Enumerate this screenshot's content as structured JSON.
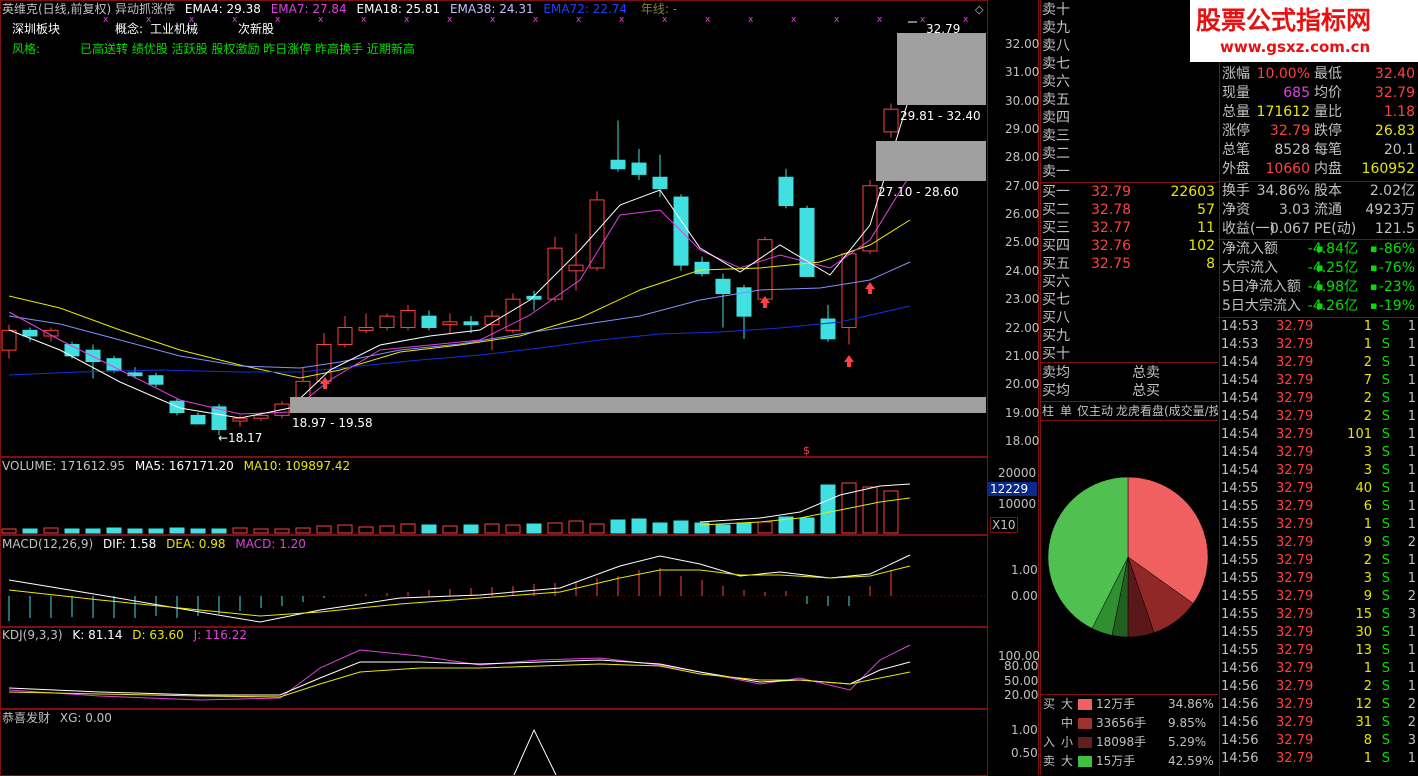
{
  "header": {
    "stock_title": "英维克(日线,前复权)",
    "indicator_name": "异动抓涨停",
    "ema4": "EMA4: 29.38",
    "ema7": "EMA7: 27.84",
    "ema18": "EMA18: 25.81",
    "ema38": "EMA38: 24.31",
    "ema72": "EMA72: 22.74",
    "year_line": "年线: -",
    "sector_label": "深圳板块",
    "concept_label": "概念:",
    "concept_value": "工业机械",
    "new_stock": "次新股",
    "style_label": "风格:",
    "style_value": "已高送转 绩优股 活跃股 股权激励 昨日涨停 昨高换手 近期新高"
  },
  "main_chart": {
    "y_ticks": [
      "32.00",
      "31.00",
      "30.00",
      "29.00",
      "28.00",
      "27.00",
      "26.00",
      "25.00",
      "24.00",
      "23.00",
      "22.00",
      "21.00",
      "20.00",
      "19.00",
      "18.00"
    ],
    "labels": {
      "top_price": "32.79",
      "range_upper": "29.81 - 32.40",
      "range_mid": "27.10 - 28.60",
      "range_lower": "18.97 - 19.58",
      "low_price": "←18.17",
      "marker_s": "$"
    }
  },
  "volume": {
    "title": "VOLUME: 171612.95",
    "ma5": "MA5: 167171.20",
    "ma10": "MA10: 109897.42",
    "y_ticks": [
      "20000",
      "10000"
    ],
    "highlight": "12229",
    "unit": "X10"
  },
  "macd": {
    "title": "MACD(12,26,9)",
    "dif": "DIF: 1.58",
    "dea": "DEA: 0.98",
    "macd": "MACD: 1.20",
    "y_ticks": [
      "1.00",
      "0.00"
    ]
  },
  "kdj": {
    "title": "KDJ(9,3,3)",
    "k": "K: 81.14",
    "d": "D: 63.60",
    "j": "J: 116.22",
    "y_ticks": [
      "100.00",
      "80.00",
      "50.00",
      "20.00"
    ]
  },
  "xg": {
    "title": "恭喜发财",
    "value": "XG: 0.00",
    "y_ticks": [
      "1.00",
      "0.50"
    ]
  },
  "sell_levels": [
    "卖十",
    "卖九",
    "卖八",
    "卖七",
    "卖六",
    "卖五",
    "卖四",
    "卖三",
    "卖二",
    "卖一"
  ],
  "buy_levels": [
    {
      "label": "买一",
      "price": "32.79",
      "vol": "22603"
    },
    {
      "label": "买二",
      "price": "32.78",
      "vol": "57"
    },
    {
      "label": "买三",
      "price": "32.77",
      "vol": "11"
    },
    {
      "label": "买四",
      "price": "32.76",
      "vol": "102"
    },
    {
      "label": "买五",
      "price": "32.75",
      "vol": "8"
    },
    {
      "label": "买六",
      "price": "",
      "vol": ""
    },
    {
      "label": "买七",
      "price": "",
      "vol": ""
    },
    {
      "label": "买八",
      "price": "",
      "vol": ""
    },
    {
      "label": "买九",
      "price": "",
      "vol": ""
    },
    {
      "label": "买十",
      "price": "",
      "vol": ""
    }
  ],
  "avg": {
    "sell_avg": "卖均",
    "total_sell": "总卖",
    "buy_avg": "买均",
    "total_buy": "总买"
  },
  "tabs": [
    "柱",
    "单",
    "仅主动",
    "龙虎看盘(成交量/按"
  ],
  "watermark": {
    "title": "股票公式指标网",
    "url": "www.gsxz.com.cn"
  },
  "stats_top": [
    {
      "l1": "涨幅",
      "v1": "10.00%",
      "c1": "#ff4040",
      "l2": "最低",
      "v2": "32.40",
      "c2": "#ff4040"
    },
    {
      "l1": "现量",
      "v1": "685",
      "c1": "#e040e0",
      "l2": "均价",
      "v2": "32.79",
      "c2": "#ff4040"
    },
    {
      "l1": "总量",
      "v1": "171612",
      "c1": "#e8e800",
      "l2": "量比",
      "v2": "1.18",
      "c2": "#ff4040"
    },
    {
      "l1": "涨停",
      "v1": "32.79",
      "c1": "#ff4040",
      "l2": "跌停",
      "v2": "26.83",
      "c2": "#e8e800"
    },
    {
      "l1": "总笔",
      "v1": "8528",
      "c1": "#c0c0c0",
      "l2": "每笔",
      "v2": "20.1",
      "c2": "#c0c0c0"
    },
    {
      "l1": "外盘",
      "v1": "10660",
      "c1": "#ff4040",
      "l2": "内盘",
      "v2": "160952",
      "c2": "#e8e800"
    }
  ],
  "stats_mid": [
    {
      "l1": "换手",
      "v1": "34.86%",
      "l2": "股本",
      "v2": "2.02亿"
    },
    {
      "l1": "净资",
      "v1": "3.03",
      "l2": "流通",
      "v2": "4923万"
    },
    {
      "l1": "收益(一)",
      "v1": "0.067",
      "l2": "PE(动)",
      "v2": "121.5"
    }
  ],
  "flows": [
    {
      "label": "净流入额",
      "v1": "-4.84亿",
      "v2": "-86%"
    },
    {
      "label": "大宗流入",
      "v1": "-4.25亿",
      "v2": "-76%"
    },
    {
      "label": "5日净流入额",
      "v1": "-4.98亿",
      "v2": "-23%"
    },
    {
      "label": "5日大宗流入",
      "v1": "-4.26亿",
      "v2": "-19%"
    }
  ],
  "ticks": [
    {
      "t": "14:53",
      "p": "32.79",
      "v": "1",
      "s": "S",
      "n": "1"
    },
    {
      "t": "14:53",
      "p": "32.79",
      "v": "1",
      "s": "S",
      "n": "1"
    },
    {
      "t": "14:54",
      "p": "32.79",
      "v": "2",
      "s": "S",
      "n": "1"
    },
    {
      "t": "14:54",
      "p": "32.79",
      "v": "7",
      "s": "S",
      "n": "1"
    },
    {
      "t": "14:54",
      "p": "32.79",
      "v": "2",
      "s": "S",
      "n": "1"
    },
    {
      "t": "14:54",
      "p": "32.79",
      "v": "2",
      "s": "S",
      "n": "1"
    },
    {
      "t": "14:54",
      "p": "32.79",
      "v": "101",
      "s": "S",
      "n": "1"
    },
    {
      "t": "14:54",
      "p": "32.79",
      "v": "3",
      "s": "S",
      "n": "1"
    },
    {
      "t": "14:54",
      "p": "32.79",
      "v": "3",
      "s": "S",
      "n": "1"
    },
    {
      "t": "14:55",
      "p": "32.79",
      "v": "40",
      "s": "S",
      "n": "1"
    },
    {
      "t": "14:55",
      "p": "32.79",
      "v": "6",
      "s": "S",
      "n": "1"
    },
    {
      "t": "14:55",
      "p": "32.79",
      "v": "1",
      "s": "S",
      "n": "1"
    },
    {
      "t": "14:55",
      "p": "32.79",
      "v": "9",
      "s": "S",
      "n": "2"
    },
    {
      "t": "14:55",
      "p": "32.79",
      "v": "2",
      "s": "S",
      "n": "1"
    },
    {
      "t": "14:55",
      "p": "32.79",
      "v": "3",
      "s": "S",
      "n": "1"
    },
    {
      "t": "14:55",
      "p": "32.79",
      "v": "9",
      "s": "S",
      "n": "2"
    },
    {
      "t": "14:55",
      "p": "32.79",
      "v": "15",
      "s": "S",
      "n": "3"
    },
    {
      "t": "14:55",
      "p": "32.79",
      "v": "30",
      "s": "S",
      "n": "1"
    },
    {
      "t": "14:55",
      "p": "32.79",
      "v": "13",
      "s": "S",
      "n": "1"
    },
    {
      "t": "14:56",
      "p": "32.79",
      "v": "1",
      "s": "S",
      "n": "1"
    },
    {
      "t": "14:56",
      "p": "32.79",
      "v": "2",
      "s": "S",
      "n": "1"
    },
    {
      "t": "14:56",
      "p": "32.79",
      "v": "12",
      "s": "S",
      "n": "2"
    },
    {
      "t": "14:56",
      "p": "32.79",
      "v": "31",
      "s": "S",
      "n": "2"
    },
    {
      "t": "14:56",
      "p": "32.79",
      "v": "8",
      "s": "S",
      "n": "3"
    },
    {
      "t": "14:56",
      "p": "32.79",
      "v": "1",
      "s": "S",
      "n": "1"
    }
  ],
  "pie_legend": [
    {
      "side": "买",
      "size": "大",
      "color": "#f06060",
      "hands": "12万手",
      "pct": "34.86%"
    },
    {
      "side": "",
      "size": "中",
      "color": "#a03030",
      "hands": "33656手",
      "pct": "9.85%"
    },
    {
      "side": "入",
      "size": "小",
      "color": "#602020",
      "hands": "18098手",
      "pct": "5.29%"
    },
    {
      "side": "卖",
      "size": "大",
      "color": "#40c040",
      "hands": "15万手",
      "pct": "42.59%"
    }
  ],
  "colors": {
    "up": "#ff4040",
    "down": "#40e0e0",
    "grid_border": "#7a1010",
    "accent_yellow": "#e8e800",
    "accent_green": "#00e000"
  }
}
